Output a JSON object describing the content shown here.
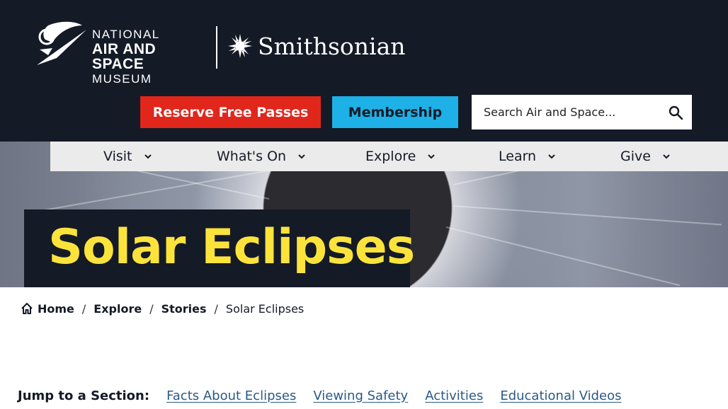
{
  "header": {
    "museum_logo": {
      "line1": "NATIONAL",
      "line2": "AIR AND SPACE",
      "line3": "MUSEUM"
    },
    "smithsonian_logo": {
      "text": "Smithsonian"
    },
    "reserve_label": "Reserve Free Passes",
    "membership_label": "Membership",
    "search": {
      "placeholder": "Search Air and Space..."
    },
    "colors": {
      "background": "#141a26",
      "reserve": "#e1261c",
      "membership": "#1eb1e7"
    }
  },
  "nav": {
    "items": [
      {
        "label": "Visit",
        "icon": "chevron-down-icon"
      },
      {
        "label": "What's On",
        "icon": "chevron-down-icon"
      },
      {
        "label": "Explore",
        "icon": "chevron-down-icon"
      },
      {
        "label": "Learn",
        "icon": "chevron-down-icon"
      },
      {
        "label": "Give",
        "icon": "chevron-down-icon"
      }
    ]
  },
  "hero": {
    "title": "Solar Eclipses",
    "title_color": "#fce33b"
  },
  "breadcrumb": {
    "items": [
      "Home",
      "Explore",
      "Stories",
      "Solar Eclipses"
    ],
    "home_icon": "home-icon"
  },
  "jump": {
    "label": "Jump to a Section:",
    "links": [
      "Facts About Eclipses",
      "Viewing Safety",
      "Activities",
      "Educational Videos"
    ],
    "link_color": "#2a5a85"
  }
}
